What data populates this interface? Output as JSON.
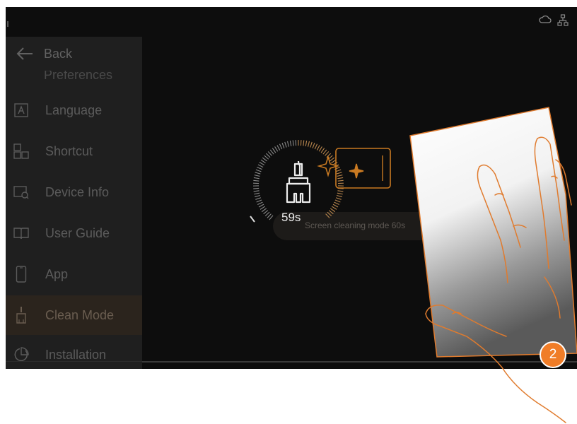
{
  "sidebar": {
    "back_label": "Back",
    "partial_item_label": "Preferences",
    "items": [
      {
        "label": "Language",
        "icon": "language-icon"
      },
      {
        "label": "Shortcut",
        "icon": "shortcut-icon"
      },
      {
        "label": "Device Info",
        "icon": "device-info-icon"
      },
      {
        "label": "User Guide",
        "icon": "user-guide-icon"
      },
      {
        "label": "App",
        "icon": "phone-icon"
      },
      {
        "label": "Clean Mode",
        "icon": "clean-mode-icon",
        "active": true
      },
      {
        "label": "Installation",
        "icon": "installation-icon"
      }
    ]
  },
  "status_bar": {
    "icons": [
      "cloud-icon",
      "network-icon"
    ]
  },
  "clean_mode": {
    "timer": "59s",
    "timer_icon": "brush-icon",
    "message": "Screen cleaning mode 60s",
    "illustration": "sparkle-tablet-icon"
  },
  "annotation": {
    "step_number": "2",
    "colors": {
      "badge": "#f07d28",
      "accent": "#e8811e"
    }
  }
}
